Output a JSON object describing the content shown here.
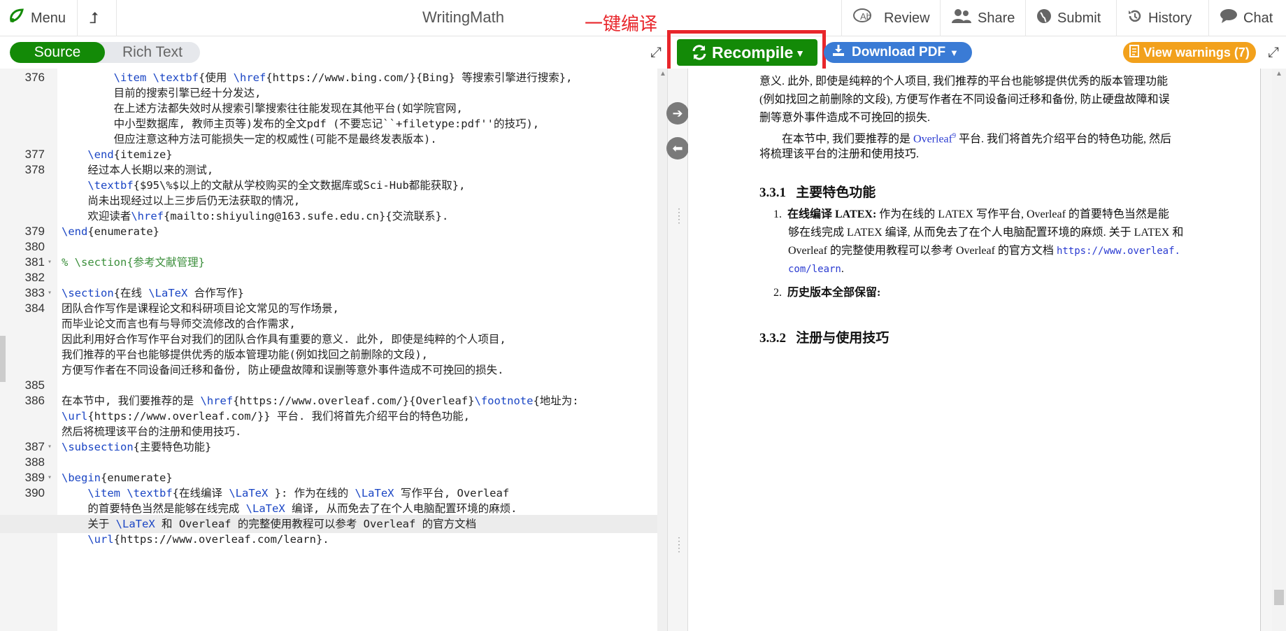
{
  "topbar": {
    "menu": "Menu",
    "title": "WritingMath",
    "annotation": "一键编译",
    "review": "Review",
    "share": "Share",
    "submit": "Submit",
    "history": "History",
    "chat": "Chat"
  },
  "editor_toggle": {
    "source": "Source",
    "rich_text": "Rich Text"
  },
  "toolbar": {
    "recompile": "Recompile",
    "download_pdf": "Download PDF",
    "view_warnings": "View warnings (7)"
  },
  "editor": {
    "lines": [
      {
        "n": "376",
        "fold": "",
        "text": "        \\item \\textbf{使用 \\href{https://www.bing.com/}{Bing} 等搜索引擎进行搜索},",
        "hl": false
      },
      {
        "n": "",
        "fold": "",
        "text": "        目前的搜索引擎已经十分发达,",
        "hl": false
      },
      {
        "n": "",
        "fold": "",
        "text": "        在上述方法都失效时从搜索引擎搜索往往能发现在其他平台(如学院官网,",
        "hl": false
      },
      {
        "n": "",
        "fold": "",
        "text": "        中小型数据库, 教师主页等)发布的全文pdf (不要忘记``+filetype:pdf''的技巧),",
        "hl": false
      },
      {
        "n": "",
        "fold": "",
        "text": "        但应注意这种方法可能损失一定的权威性(可能不是最终发表版本).",
        "hl": false
      },
      {
        "n": "377",
        "fold": "",
        "text": "    \\end{itemize}",
        "hl": false
      },
      {
        "n": "378",
        "fold": "",
        "text": "    经过本人长期以来的测试,",
        "hl": false
      },
      {
        "n": "",
        "fold": "",
        "text": "    \\textbf{$95\\%$以上的文献从学校购买的全文数据库或Sci-Hub都能获取},",
        "hl": false
      },
      {
        "n": "",
        "fold": "",
        "text": "    尚未出现经过以上三步后仍无法获取的情况,",
        "hl": false
      },
      {
        "n": "",
        "fold": "",
        "text": "    欢迎读者\\href{mailto:shiyuling@163.sufe.edu.cn}{交流联系}.",
        "hl": false
      },
      {
        "n": "379",
        "fold": "",
        "text": "\\end{enumerate}",
        "hl": false
      },
      {
        "n": "380",
        "fold": "",
        "text": "",
        "hl": false
      },
      {
        "n": "381",
        "fold": "▾",
        "text": "% \\section{参考文献管理}",
        "hl": false
      },
      {
        "n": "382",
        "fold": "",
        "text": "",
        "hl": false
      },
      {
        "n": "383",
        "fold": "▾",
        "text": "\\section{在线 \\LaTeX 合作写作}",
        "hl": false
      },
      {
        "n": "384",
        "fold": "",
        "text": "团队合作写作是课程论文和科研项目论文常见的写作场景,",
        "hl": false
      },
      {
        "n": "",
        "fold": "",
        "text": "而毕业论文而言也有与导师交流修改的合作需求,",
        "hl": false
      },
      {
        "n": "",
        "fold": "",
        "text": "因此利用好合作写作平台对我们的团队合作具有重要的意义. 此外, 即使是纯粹的个人项目,",
        "hl": false
      },
      {
        "n": "",
        "fold": "",
        "text": "我们推荐的平台也能够提供优秀的版本管理功能(例如找回之前删除的文段),",
        "hl": false
      },
      {
        "n": "",
        "fold": "",
        "text": "方便写作者在不同设备间迁移和备份, 防止硬盘故障和误删等意外事件造成不可挽回的损失.",
        "hl": false
      },
      {
        "n": "385",
        "fold": "",
        "text": "",
        "hl": false
      },
      {
        "n": "386",
        "fold": "",
        "text": "在本节中, 我们要推荐的是 \\href{https://www.overleaf.com/}{Overleaf}\\footnote{地址为:",
        "hl": false
      },
      {
        "n": "",
        "fold": "",
        "text": "\\url{https://www.overleaf.com/}} 平台. 我们将首先介绍平台的特色功能,",
        "hl": false
      },
      {
        "n": "",
        "fold": "",
        "text": "然后将梳理该平台的注册和使用技巧.",
        "hl": false
      },
      {
        "n": "387",
        "fold": "▾",
        "text": "\\subsection{主要特色功能}",
        "hl": false
      },
      {
        "n": "388",
        "fold": "",
        "text": "",
        "hl": false
      },
      {
        "n": "389",
        "fold": "▾",
        "text": "\\begin{enumerate}",
        "hl": false
      },
      {
        "n": "390",
        "fold": "",
        "text": "    \\item \\textbf{在线编译 \\LaTeX }: 作为在线的 \\LaTeX 写作平台, Overleaf",
        "hl": false
      },
      {
        "n": "",
        "fold": "",
        "text": "    的首要特色当然是能够在线完成 \\LaTeX 编译, 从而免去了在个人电脑配置环境的麻烦.",
        "hl": false
      },
      {
        "n": "",
        "fold": "",
        "text": "    关于 \\LaTeX 和 Overleaf 的完整使用教程可以参考 Overleaf 的官方文档",
        "hl": true
      },
      {
        "n": "",
        "fold": "",
        "text": "    \\url{https://www.overleaf.com/learn}.",
        "hl": false
      }
    ]
  },
  "pdf": {
    "para1_l1": "意义. 此外, 即使是纯粹的个人项目, 我们推荐的平台也能够提供优秀的版本管理功能",
    "para1_l2": "(例如找回之前删除的文段), 方便写作者在不同设备间迁移和备份, 防止硬盘故障和误",
    "para1_l3": "删等意外事件造成不可挽回的损失.",
    "para2_l1_pre": "在本节中, 我们要推荐的是 ",
    "para2_link": "Overleaf",
    "para2_sup": "9",
    "para2_l1_post": " 平台. 我们将首先介绍平台的特色功能, 然后",
    "para2_l2": "将梳理该平台的注册和使用技巧.",
    "sec1_num": "3.3.1",
    "sec1_title": "主要特色功能",
    "item1_num": "1.",
    "item1_bold": "在线编译 LATEX:",
    "item1_l1": " 作为在线的 LATEX 写作平台, Overleaf 的首要特色当然是能",
    "item1_l2": "够在线完成 LATEX 编译, 从而免去了在个人电脑配置环境的麻烦. 关于 LATEX 和",
    "item1_l3_pre": "Overleaf 的完整使用教程可以参考 Overleaf 的官方文档 ",
    "item1_url1": "https://www.overleaf.",
    "item1_url2": "com/learn",
    "item1_l4_post": ".",
    "item2_num": "2.",
    "item2_bold": "历史版本全部保留:",
    "sec2_num": "3.3.2",
    "sec2_title": "注册与使用技巧"
  },
  "colors": {
    "green": "#138a07",
    "blue": "#3a7bd5",
    "orange": "#f2a11c",
    "red_annotation": "#e8262b"
  }
}
